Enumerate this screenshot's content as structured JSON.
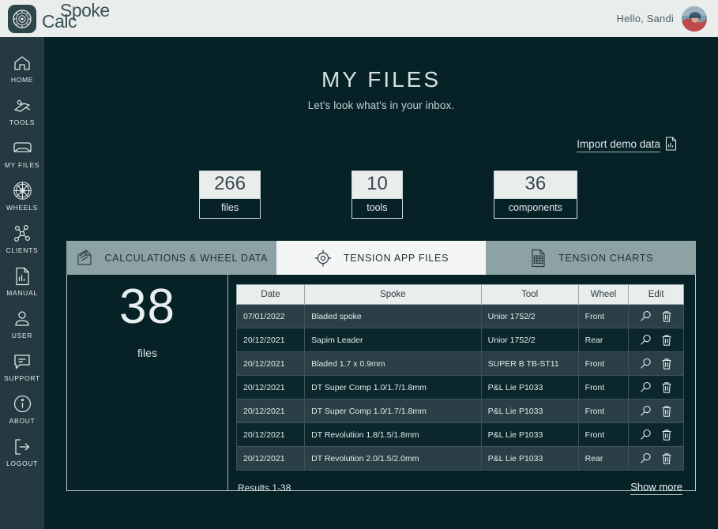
{
  "brand": {
    "word_top": "Spoke",
    "word_bottom": "Calc",
    "logo_icon": "wheel-logo-icon"
  },
  "header": {
    "greeting": "Hello, Sandi",
    "avatar_icon": "user-avatar"
  },
  "sidebar": {
    "items": [
      {
        "label": "HOME",
        "icon": "home-icon"
      },
      {
        "label": "TOOLS",
        "icon": "tools-icon"
      },
      {
        "label": "MY FILES",
        "icon": "inbox-icon"
      },
      {
        "label": "WHEELS",
        "icon": "wheel-icon"
      },
      {
        "label": "CLIENTS",
        "icon": "clients-network-icon"
      },
      {
        "label": "MANUAL",
        "icon": "manual-document-icon"
      },
      {
        "label": "USER",
        "icon": "user-icon"
      },
      {
        "label": "SUPPORT",
        "icon": "chat-bubble-icon"
      },
      {
        "label": "ABOUT",
        "icon": "info-circle-icon"
      },
      {
        "label": "LOGOUT",
        "icon": "logout-arrow-icon"
      }
    ]
  },
  "page": {
    "title": "MY FILES",
    "subtitle": "Let's look what's in your inbox.",
    "import_link": "Import demo data",
    "import_icon": "file-import-icon"
  },
  "stats": [
    {
      "value": "266",
      "label": "files"
    },
    {
      "value": "10",
      "label": "tools"
    },
    {
      "value": "36",
      "label": "components"
    }
  ],
  "tabs": [
    {
      "label": "CALCULATIONS & WHEEL DATA",
      "icon": "calculator-icon",
      "active": false
    },
    {
      "label": "TENSION APP FILES",
      "icon": "target-crosshair-icon",
      "active": true
    },
    {
      "label": "TENSION CHARTS",
      "icon": "spreadsheet-icon",
      "active": false
    }
  ],
  "summary": {
    "count": "38",
    "label": "files"
  },
  "table": {
    "columns": [
      "Date",
      "Spoke",
      "Tool",
      "Wheel",
      "Edit"
    ],
    "rows": [
      {
        "date": "07/01/2022",
        "spoke": "Bladed spoke",
        "tool": "Unior 1752/2",
        "wheel": "Front"
      },
      {
        "date": "20/12/2021",
        "spoke": "Sapim Leader",
        "tool": "Unior 1752/2",
        "wheel": "Rear"
      },
      {
        "date": "20/12/2021",
        "spoke": "Bladed 1.7 x 0.9mm",
        "tool": "SUPER B TB-ST11",
        "wheel": "Front"
      },
      {
        "date": "20/12/2021",
        "spoke": "DT Super Comp 1.0/1.7/1.8mm",
        "tool": "P&L Lie P1033",
        "wheel": "Front"
      },
      {
        "date": "20/12/2021",
        "spoke": "DT Super Comp 1.0/1.7/1.8mm",
        "tool": "P&L Lie P1033",
        "wheel": "Front"
      },
      {
        "date": "20/12/2021",
        "spoke": "DT Revolution 1.8/1.5/1.8mm",
        "tool": "P&L Lie P1033",
        "wheel": "Front"
      },
      {
        "date": "20/12/2021",
        "spoke": "DT Revolution 2.0/1.5/2.0mm",
        "tool": "P&L Lie P1033",
        "wheel": "Rear"
      }
    ],
    "row_actions": {
      "view_icon": "magnifier-icon",
      "delete_icon": "trash-icon"
    },
    "results_text": "Results 1-38",
    "show_more": "Show more"
  },
  "colors": {
    "background": "#072227",
    "sidebar": "#243a40",
    "topbar": "#e9edec",
    "tab_active": "#f3f6f5",
    "tab_inactive": "#8da3a3",
    "row_odd": "#2a4046",
    "row_even": "#0b272c",
    "text_light": "#e2eaeb"
  }
}
